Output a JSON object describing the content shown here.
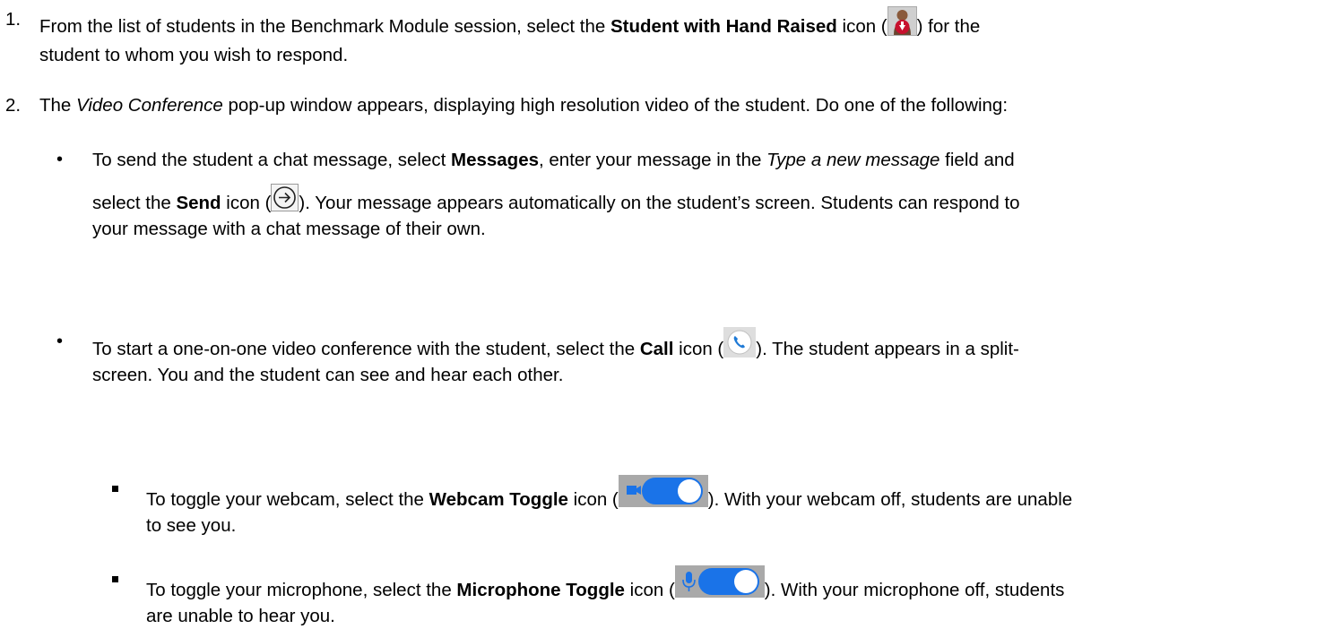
{
  "steps": [
    {
      "number": "1.",
      "line1_pre": "From the list of students in the Benchmark Module session, select the ",
      "line1_bold": "Student with Hand Raised",
      "line1_mid": " icon (",
      "line1_post": ") for the",
      "line2": "student to whom you wish to respond."
    },
    {
      "number": "2.",
      "pre": "The ",
      "italic": "Video Conference",
      "post": " pop-up window appears, displaying high resolution video of the student. Do one of the following:"
    }
  ],
  "bullets": [
    {
      "symbol": "•",
      "l1_pre": "To send the student a chat message, select ",
      "l1_bold": "Messages",
      "l1_mid": ", enter your message in the ",
      "l1_italic": "Type a new message",
      "l1_post": " field and",
      "l2_pre": "select the ",
      "l2_bold": "Send",
      "l2_mid": " icon (",
      "l2_post": "). Your message appears automatically on the student’s screen. Students can respond to",
      "l3": "your message with a chat message of their own."
    },
    {
      "symbol": "•",
      "l1_pre": "To start a one-on-one video conference with the student, select the ",
      "l1_bold": "Call",
      "l1_mid": " icon (",
      "l1_post": "). The student appears in a split-",
      "l2": "screen. You and the student can see and hear each other."
    }
  ],
  "subbullets": [
    {
      "l1_pre": "To toggle your webcam, select the ",
      "l1_bold": "Webcam Toggle",
      "l1_mid": " icon (",
      "l1_post": "). With your webcam off, students are unable",
      "l2": "to see you."
    },
    {
      "l1_pre": "To toggle your microphone, select the ",
      "l1_bold": "Microphone Toggle",
      "l1_mid": " icon (",
      "l1_post": "). With your microphone off, students",
      "l2": "are unable to hear you."
    }
  ],
  "icons": {
    "hand": "student-hand-raised-icon",
    "send": "send-arrow-icon",
    "call": "phone-call-icon",
    "webcam": "webcam-toggle-icon",
    "mic": "microphone-toggle-icon"
  },
  "colors": {
    "hand_red": "#c8102e",
    "call_blue": "#1f7ad6",
    "toggle_blue": "#1a73e8",
    "toggle_bg": "#a9a9a9"
  }
}
